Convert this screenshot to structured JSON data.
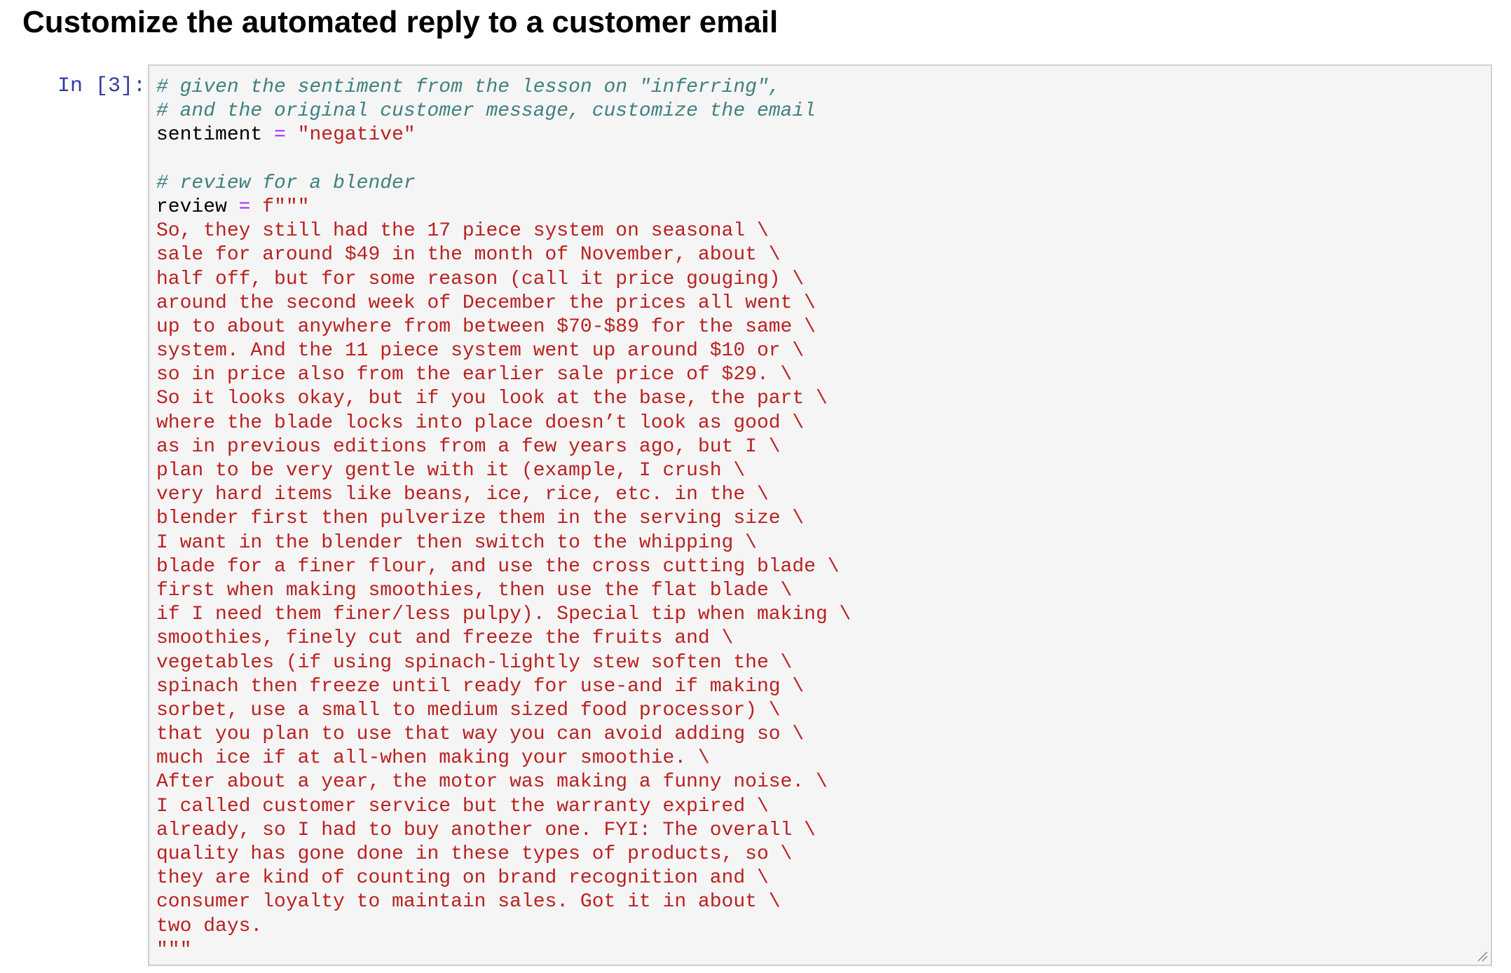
{
  "heading": "Customize the automated reply to a customer email",
  "cell": {
    "prompt": "In [3]:",
    "comment1": "# given the sentiment from the lesson on \"inferring\",",
    "comment2": "# and the original customer message, customize the email",
    "sentiment_var": "sentiment",
    "assign_op": "=",
    "sentiment_value": "\"negative\"",
    "comment3": "# review for a blender",
    "review_var": "review",
    "fstring_open": "f\"\"\"",
    "review_lines": [
      "So, they still had the 17 piece system on seasonal \\",
      "sale for around $49 in the month of November, about \\",
      "half off, but for some reason (call it price gouging) \\",
      "around the second week of December the prices all went \\",
      "up to about anywhere from between $70-$89 for the same \\",
      "system. And the 11 piece system went up around $10 or \\",
      "so in price also from the earlier sale price of $29. \\",
      "So it looks okay, but if you look at the base, the part \\",
      "where the blade locks into place doesn’t look as good \\",
      "as in previous editions from a few years ago, but I \\",
      "plan to be very gentle with it (example, I crush \\",
      "very hard items like beans, ice, rice, etc. in the \\",
      "blender first then pulverize them in the serving size \\",
      "I want in the blender then switch to the whipping \\",
      "blade for a finer flour, and use the cross cutting blade \\",
      "first when making smoothies, then use the flat blade \\",
      "if I need them finer/less pulpy). Special tip when making \\",
      "smoothies, finely cut and freeze the fruits and \\",
      "vegetables (if using spinach-lightly stew soften the \\",
      "spinach then freeze until ready for use-and if making \\",
      "sorbet, use a small to medium sized food processor) \\",
      "that you plan to use that way you can avoid adding so \\",
      "much ice if at all-when making your smoothie. \\",
      "After about a year, the motor was making a funny noise. \\",
      "I called customer service but the warranty expired \\",
      "already, so I had to buy another one. FYI: The overall \\",
      "quality has gone done in these types of products, so \\",
      "they are kind of counting on brand recognition and \\",
      "consumer loyalty to maintain sales. Got it in about \\",
      "two days."
    ],
    "fstring_close": "\"\"\""
  }
}
